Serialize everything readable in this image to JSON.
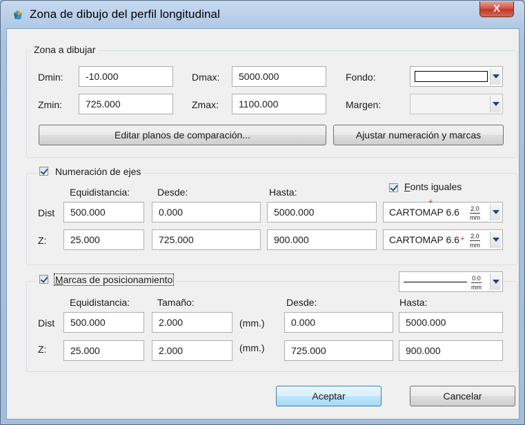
{
  "window": {
    "title": "Zona de dibujo del perfil longitudinal",
    "close_label": "X"
  },
  "zona": {
    "legend": "Zona a dibujar",
    "dmin_label": "Dmin:",
    "dmin_value": "-10.000",
    "dmax_label": "Dmax:",
    "dmax_value": "5000.000",
    "zmin_label": "Zmin:",
    "zmin_value": "725.000",
    "zmax_label": "Zmax:",
    "zmax_value": "1100.000",
    "fondo_label": "Fondo:",
    "fondo_color": "#ffffff",
    "margen_label": "Margen:",
    "editar_button": "Editar planos de comparación...",
    "ajustar_button": "Ajustar numeración y marcas"
  },
  "numeracion": {
    "legend": "Numeración de ejes",
    "checked": true,
    "col_equidistancia": "Equidistancia:",
    "col_desde": "Desde:",
    "col_hasta": "Hasta:",
    "fonts_iguales_label_first": "F",
    "fonts_iguales_label_rest": "onts iguales",
    "fonts_iguales_checked": true,
    "rows": [
      {
        "label": "Dist",
        "equidistancia": "500.000",
        "desde": "0.000",
        "hasta": "5000.000",
        "font": "CARTOMAP 6.6",
        "size_top": "2.0",
        "size_bottom": "mm"
      },
      {
        "label": "Z:",
        "equidistancia": "25.000",
        "desde": "725.000",
        "hasta": "900.000",
        "font": "CARTOMAP 6.6",
        "size_top": "2.0",
        "size_bottom": "mm"
      }
    ]
  },
  "marcas": {
    "legend_first": "M",
    "legend_rest": "arcas de posicionamiento",
    "checked": true,
    "line_size_top": "0.0",
    "line_size_bottom": "mm",
    "col_equidistancia": "Equidistancia:",
    "col_tamano": "Tamaño:",
    "col_desde": "Desde:",
    "col_hasta": "Hasta:",
    "rows": [
      {
        "label": "Dist",
        "equidistancia": "500.000",
        "tamano": "2.000",
        "unit": "(mm.)",
        "desde": "0.000",
        "hasta": "5000.000"
      },
      {
        "label": "Z:",
        "equidistancia": "25.000",
        "tamano": "2.000",
        "unit": "(mm.)",
        "desde": "725.000",
        "hasta": "900.000"
      }
    ]
  },
  "footer": {
    "accept_label": "Aceptar",
    "cancel_label": "Cancelar"
  }
}
